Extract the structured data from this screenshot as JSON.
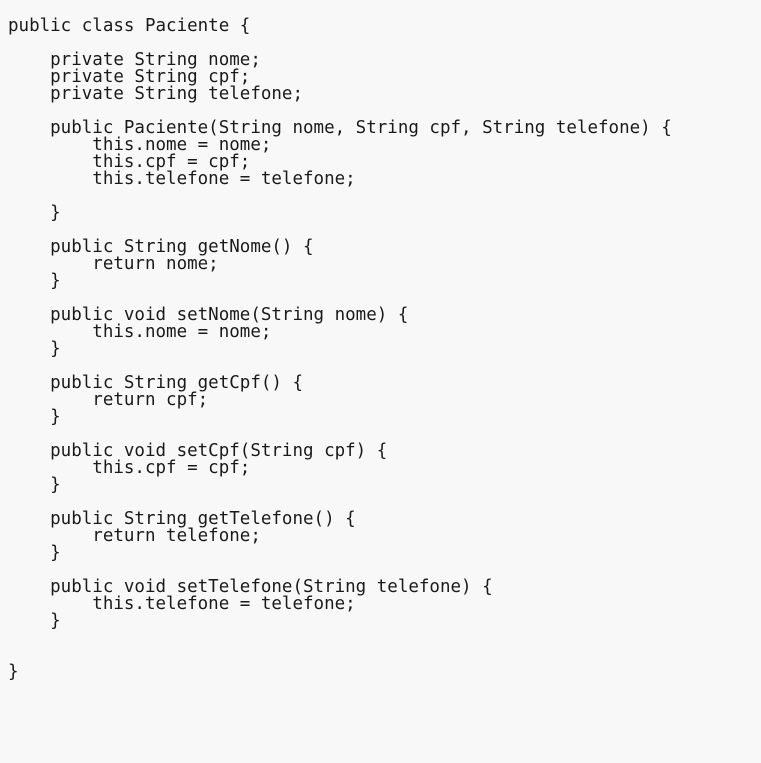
{
  "code": {
    "lines": [
      "public class Paciente {",
      "    private String nome;",
      "    private String cpf;",
      "    private String telefone;",
      "    public Paciente(String nome, String cpf, String telefone) {",
      "        this.nome = nome;",
      "        this.cpf = cpf;",
      "        this.telefone = telefone;",
      "    }",
      "    public String getNome() {",
      "        return nome;",
      "    }",
      "    public void setNome(String nome) {",
      "        this.nome = nome;",
      "    }",
      "    public String getCpf() {",
      "        return cpf;",
      "    }",
      "    public void setCpf(String cpf) {",
      "        this.cpf = cpf;",
      "    }",
      "    public String getTelefone() {",
      "        return telefone;",
      "    }",
      "    public void setTelefone(String telefone) {",
      "        this.telefone = telefone;",
      "    }",
      "}"
    ]
  }
}
